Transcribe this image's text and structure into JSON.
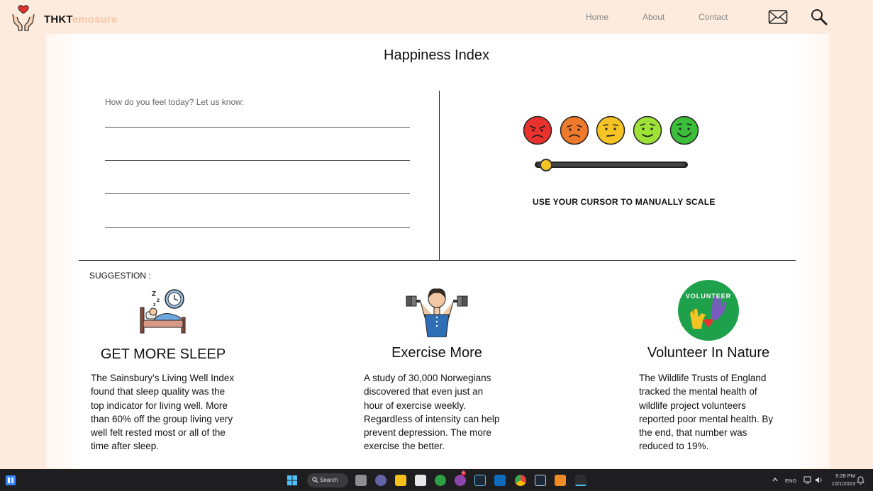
{
  "header": {
    "brand_part1": "THKT",
    "brand_part2": "emosure",
    "nav": [
      "Home",
      "About",
      "Contact"
    ]
  },
  "main": {
    "title": "Happiness Index",
    "feel_prompt": "How do you feel today? Let us know:",
    "scale_instruction": "USE YOUR CURSOR TO MANUALLY SCALE",
    "mood_faces": [
      "angry",
      "sad",
      "neutral",
      "content",
      "happy"
    ],
    "mood_colors": [
      "#e9312d",
      "#f07a2c",
      "#f6c324",
      "#9ee238",
      "#3bbf3a"
    ],
    "slider_value_fraction": 0.06
  },
  "suggestions": {
    "label": "SUGGESTION :",
    "items": [
      {
        "icon": "sleep-icon",
        "title": "GET MORE SLEEP",
        "text_lines": [
          "The Sainsbury’s Living Well Index",
          "found that sleep quality was the",
          "top indicator for living well. More",
          "than 60% off the group living very",
          "well felt rested most or all of the",
          "time after sleep."
        ]
      },
      {
        "icon": "exercise-icon",
        "title": "Exercise More",
        "text_lines": [
          "A study of 30,000 Norwegians",
          "discovered that even just an",
          "hour of exercise weekly.",
          "Regardless of intensity can help",
          "prevent depression. The more",
          "exercise the better."
        ]
      },
      {
        "icon": "volunteer-icon",
        "title": "Volunteer In Nature",
        "badge_text": "VOLUNTEER",
        "text_lines": [
          "The Wildlife Trusts of England",
          "tracked the mental health of",
          "wildlife project volunteers",
          "reported poor mental health. By",
          "the end, that number was",
          "reduced to 19%."
        ]
      }
    ]
  },
  "taskbar": {
    "search_label": "Search",
    "language": "ENG",
    "time": "9:28 PM",
    "date": "10/1/2023",
    "notification_count": "6"
  }
}
